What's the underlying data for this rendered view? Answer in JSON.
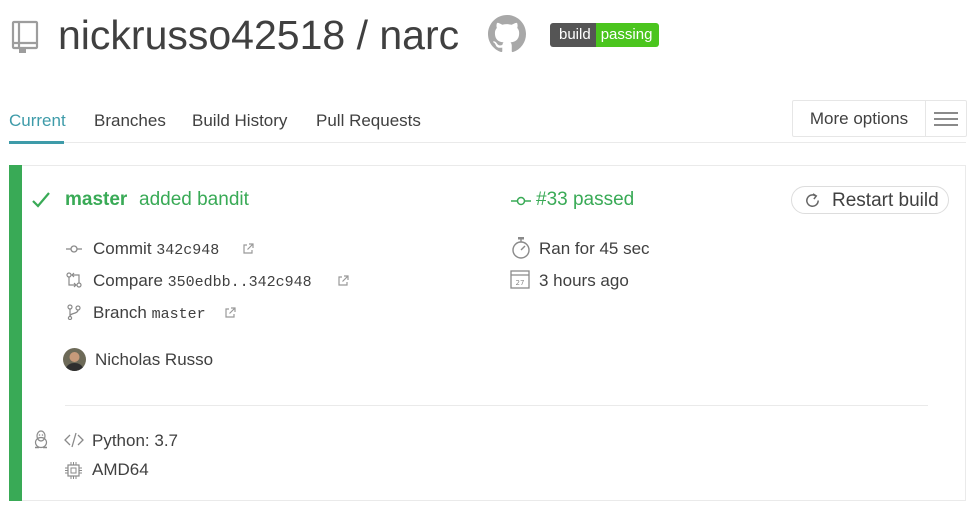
{
  "header": {
    "repo_title": "nickrusso42518 / narc",
    "badge_left": "build",
    "badge_right": "passing"
  },
  "tabs": [
    {
      "label": "Current",
      "active": true
    },
    {
      "label": "Branches"
    },
    {
      "label": "Build History"
    },
    {
      "label": "Pull Requests"
    }
  ],
  "more_options_label": "More options",
  "build": {
    "status": "passed",
    "branch": "master",
    "commit_message": "added bandit",
    "number_text": "#33 passed",
    "restart_label": "Restart build",
    "commit_label": "Commit",
    "commit_sha": "342c948",
    "compare_label": "Compare",
    "compare_range": "350edbb..342c948",
    "branch_label": "Branch",
    "branch_value": "master",
    "author": "Nicholas Russo",
    "duration": "Ran for 45 sec",
    "finished": "3 hours ago",
    "calendar_day": "27",
    "language": "Python: 3.7",
    "arch": "AMD64"
  },
  "colors": {
    "passed": "#39aa56",
    "active_tab": "#3e9ba9",
    "badge_passing": "#4bc51e",
    "badge_build": "#555555"
  },
  "icons": [
    "repo-icon",
    "github-icon",
    "menu-icon",
    "check-icon",
    "commit-icon",
    "compare-icon",
    "branch-icon",
    "external-link-icon",
    "stopwatch-icon",
    "calendar-icon",
    "restart-icon",
    "linux-icon",
    "code-icon",
    "cpu-icon"
  ]
}
